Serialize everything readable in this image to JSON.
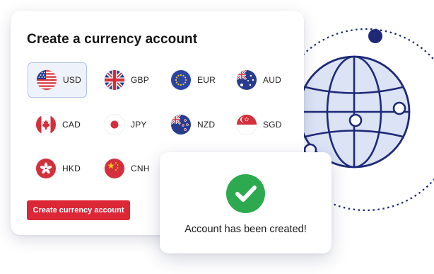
{
  "card": {
    "title": "Create a currency account",
    "currencies": [
      {
        "code": "USD",
        "flag": "us-flag-icon",
        "selected": true
      },
      {
        "code": "GBP",
        "flag": "uk-flag-icon",
        "selected": false
      },
      {
        "code": "EUR",
        "flag": "eu-flag-icon",
        "selected": false
      },
      {
        "code": "AUD",
        "flag": "au-flag-icon",
        "selected": false
      },
      {
        "code": "CAD",
        "flag": "ca-flag-icon",
        "selected": false
      },
      {
        "code": "JPY",
        "flag": "jp-flag-icon",
        "selected": false
      },
      {
        "code": "NZD",
        "flag": "nz-flag-icon",
        "selected": false
      },
      {
        "code": "SGD",
        "flag": "sg-flag-icon",
        "selected": false
      },
      {
        "code": "HKD",
        "flag": "hk-flag-icon",
        "selected": false
      },
      {
        "code": "CNH",
        "flag": "cn-flag-icon",
        "selected": false
      }
    ],
    "button_label": "Create currency account"
  },
  "toast": {
    "message": "Account has been created!",
    "icon": "checkmark-icon"
  },
  "illustration": {
    "icon": "globe-icon"
  },
  "colors": {
    "accent_red": "#dc2737",
    "success_green": "#2daa4f",
    "navy": "#1e2a78",
    "globe_fill": "#dce3f5",
    "selected_bg": "#eef2fa"
  }
}
